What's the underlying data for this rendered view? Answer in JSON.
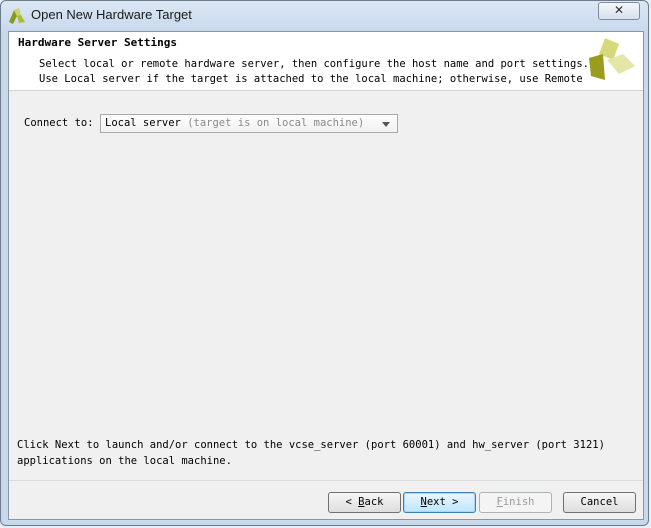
{
  "window": {
    "title": "Open New Hardware Target",
    "close_glyph": "✕"
  },
  "header": {
    "title": "Hardware Server Settings",
    "line1": "Select local or remote hardware server, then configure the host name and port settings.",
    "line2": "Use Local server if the target is attached to the local machine; otherwise, use Remote"
  },
  "connect": {
    "label": "Connect to:",
    "selected_value": "Local server",
    "selected_hint": "(target is on local machine)"
  },
  "footer": {
    "line1": "Click Next to launch and/or connect to the vcse_server (port 60001) and hw_server (port 3121)",
    "line2": "applications on the local machine."
  },
  "buttons": {
    "back_prefix": "< ",
    "back_mnemonic": "B",
    "back_rest": "ack",
    "next_mnemonic": "N",
    "next_rest": "ext",
    "next_suffix": " >",
    "finish_mnemonic": "F",
    "finish_rest": "inish",
    "cancel": "Cancel"
  },
  "colors": {
    "logo_dark": "#9b9b1e",
    "logo_light": "#d4d97a"
  }
}
